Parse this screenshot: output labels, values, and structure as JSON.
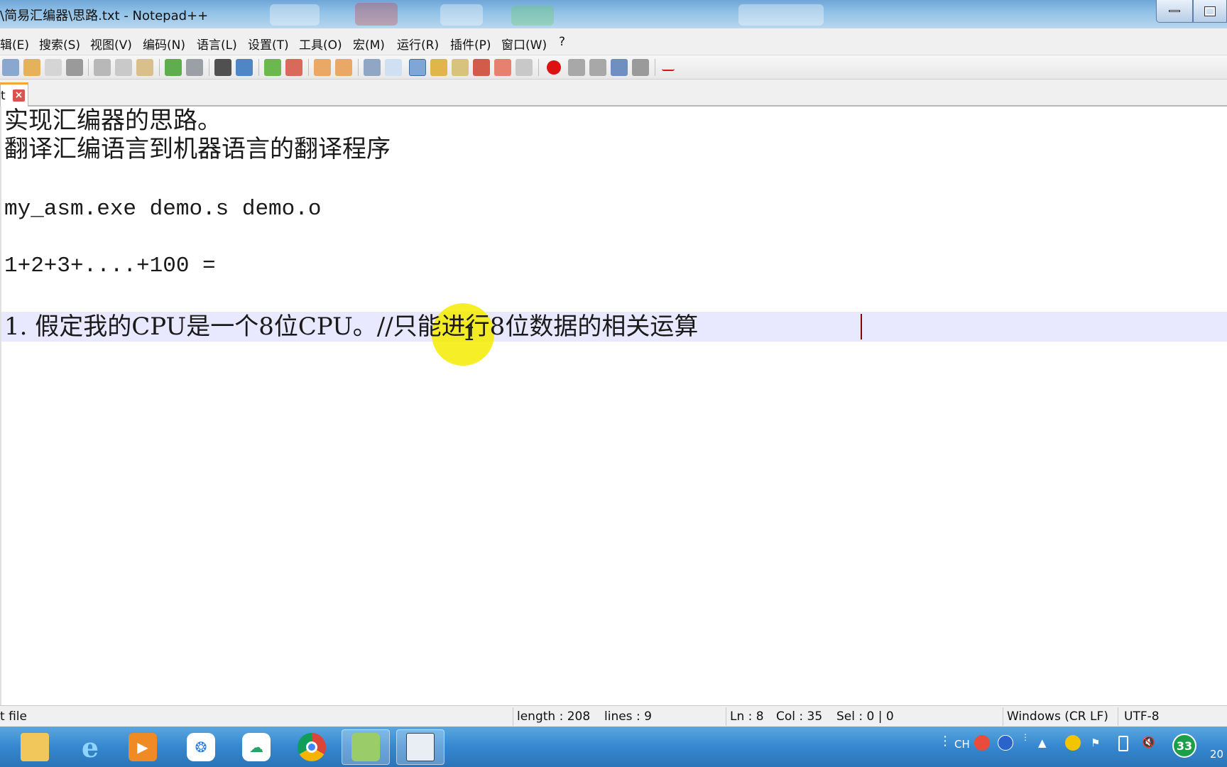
{
  "window": {
    "title": "\\简易汇编器\\思路.txt - Notepad++"
  },
  "menu": [
    "辑(E)",
    "搜索(S)",
    "视图(V)",
    "编码(N)",
    "语言(L)",
    "设置(T)",
    "工具(O)",
    "宏(M)",
    "运行(R)",
    "插件(P)",
    "窗口(W)",
    "?"
  ],
  "tab": {
    "label": "t",
    "close": "×"
  },
  "editor": {
    "lines": [
      "实现汇编器的思路。",
      "翻译汇编语言到机器语言的翻译程序",
      "",
      "my_asm.exe demo.s demo.o",
      "",
      "1+2+3+....+100 =",
      "",
      "1. 假定我的CPU是一个8位CPU。//只能进行8位数据的相关运算"
    ]
  },
  "status": {
    "file_type": "t file",
    "length": "length : 208",
    "lines": "lines : 9",
    "ln": "Ln : 8",
    "col": "Col : 35",
    "sel": "Sel : 0 | 0",
    "eol": "Windows (CR LF)",
    "encoding": "UTF-8"
  },
  "taskbar": {
    "apps": [
      "file-explorer",
      "internet-explorer",
      "media-player",
      "baidu-netdisk",
      "cloud-sync",
      "chrome",
      "notepad-plus-plus",
      "document-viewer"
    ],
    "tray": {
      "ime": "CH",
      "badge": "33",
      "clock": "20"
    }
  }
}
